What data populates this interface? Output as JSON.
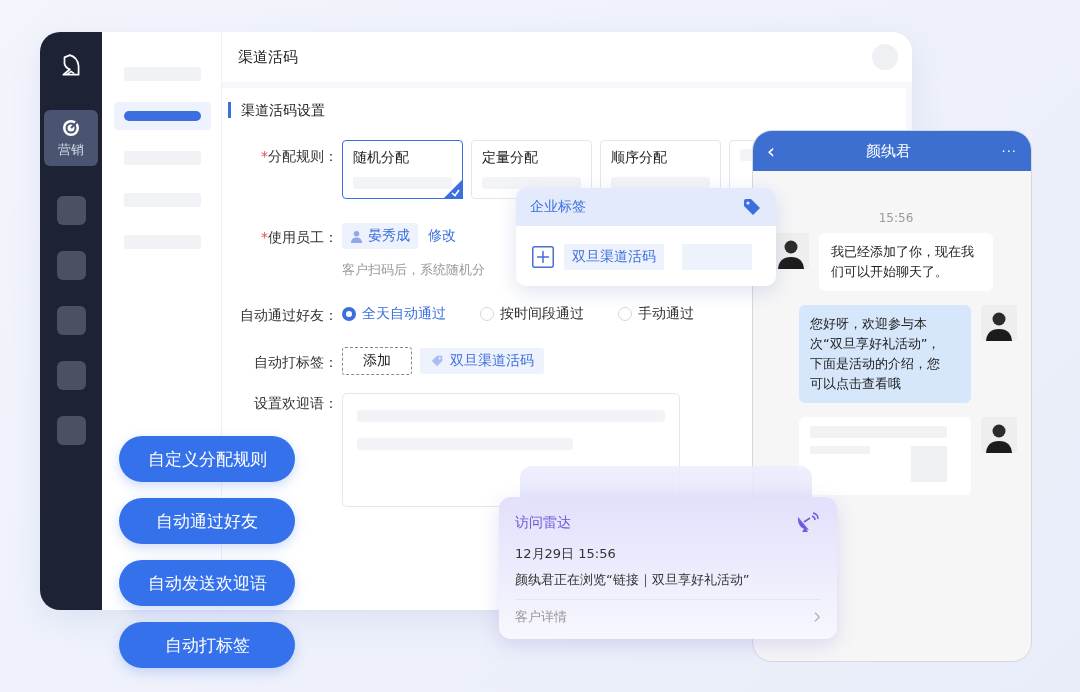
{
  "sidebar": {
    "items": [
      {
        "label": "营销",
        "selected": true
      },
      {
        "selected": false
      },
      {
        "selected": false
      },
      {
        "selected": false
      },
      {
        "selected": false
      },
      {
        "selected": false
      }
    ]
  },
  "subnav": {
    "items": [
      {
        "selected": false
      },
      {
        "selected": true
      },
      {
        "selected": false
      },
      {
        "selected": false
      },
      {
        "selected": false
      }
    ]
  },
  "header": {
    "title": "渠道活码"
  },
  "section": {
    "title": "渠道活码设置"
  },
  "form": {
    "rule": {
      "mark": "*",
      "label": "分配规则：",
      "options": [
        {
          "label": "随机分配",
          "selected": true
        },
        {
          "label": "定量分配",
          "selected": false
        },
        {
          "label": "顺序分配",
          "selected": false
        },
        {
          "selected": false
        }
      ]
    },
    "staff": {
      "mark": "*",
      "label": "使用员工：",
      "name": "晏秀成",
      "action": "修改",
      "hint": "客户扫码后，系统随机分"
    },
    "friend": {
      "label": "自动通过好友：",
      "options": [
        {
          "label": "全天自动通过",
          "selected": true
        },
        {
          "label": "按时间段通过",
          "selected": false
        },
        {
          "label": "手动通过",
          "selected": false
        }
      ]
    },
    "tags": {
      "label": "自动打标签：",
      "add": "添加",
      "tag": "双旦渠道活码"
    },
    "welcome": {
      "label": "设置欢迎语："
    }
  },
  "features": [
    "自定义分配规则",
    "自动通过好友",
    "自动发送欢迎语",
    "自动打标签"
  ],
  "tag_popup": {
    "title": "企业标签",
    "tag": "双旦渠道活码"
  },
  "chat": {
    "title": "颜纨君",
    "back": "‹",
    "more": "···",
    "time": "15:56",
    "messages": [
      {
        "incoming": true,
        "kind": "text",
        "text": "我已经添加了你，现在我们可以开始聊天了。"
      },
      {
        "incoming": false,
        "kind": "text",
        "text": "您好呀，欢迎参与本次“双旦享好礼活动”，下面是活动的介绍，您可以点击查看哦"
      },
      {
        "incoming": false,
        "kind": "card"
      }
    ]
  },
  "radar": {
    "title": "访问雷达",
    "time": "12月29日 15:56",
    "text": "颜纨君正在浏览“链接｜双旦享好礼活动”",
    "link": "客户详情"
  }
}
